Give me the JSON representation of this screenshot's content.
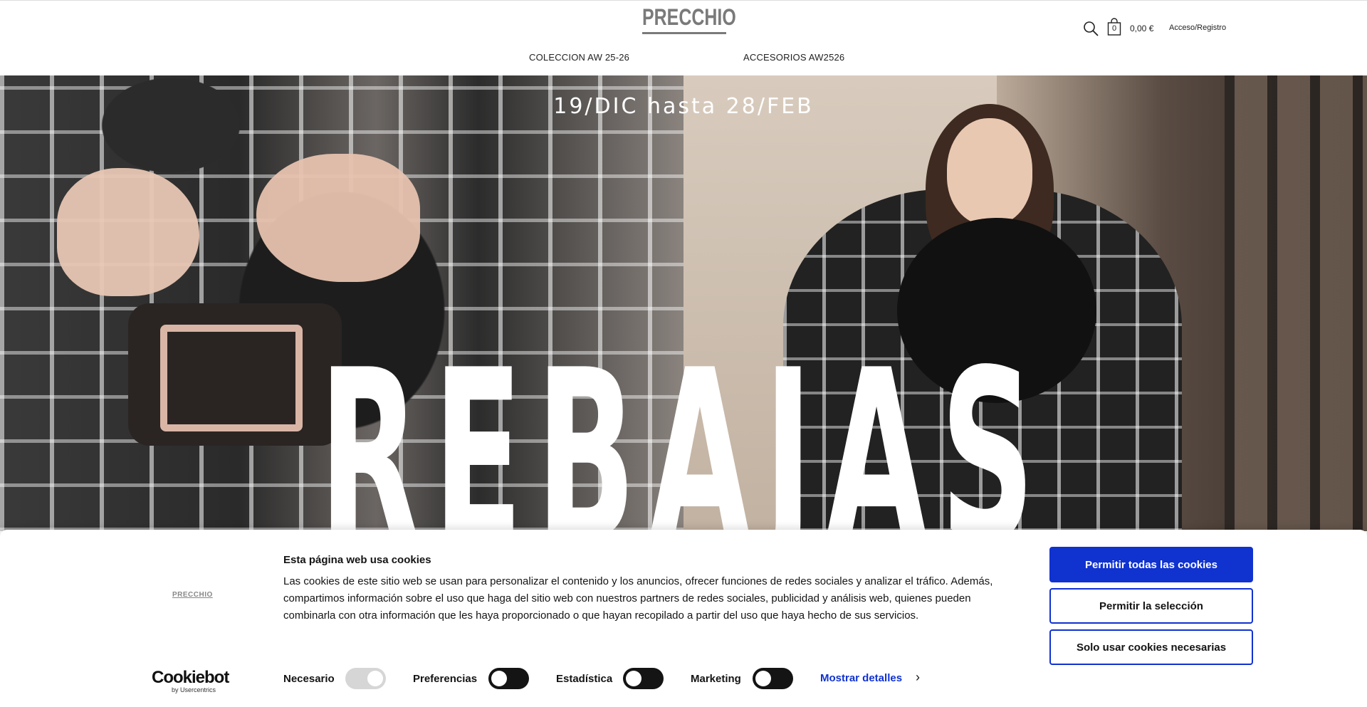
{
  "header": {
    "logo": "PRECCHIO",
    "nav": [
      "COLECCION AW 25-26",
      "ACCESORIOS AW2526"
    ],
    "cart_count": "0",
    "cart_total": "0,00 €",
    "login": "Acceso/Registro"
  },
  "hero": {
    "date": "19/DIC hasta 28/FEB",
    "title": "REBAJAS"
  },
  "cookie": {
    "logo": "PRECCHIO",
    "title": "Esta página web usa cookies",
    "text": "Las cookies de este sitio web se usan para personalizar el contenido y los anuncios, ofrecer funciones de redes sociales y analizar el tráfico. Además, compartimos información sobre el uso que haga del sitio web con nuestros partners de redes sociales, publicidad y análisis web, quienes pueden combinarla con otra información que les haya proporcionado o que hayan recopilado a partir del uso que haya hecho de sus servicios.",
    "toggles": [
      {
        "label": "Necesario",
        "checked": true,
        "disabled": true
      },
      {
        "label": "Preferencias",
        "checked": false
      },
      {
        "label": "Estadística",
        "checked": false
      },
      {
        "label": "Marketing",
        "checked": false
      }
    ],
    "details": "Mostrar detalles",
    "buttons": {
      "allow_all": "Permitir todas las cookies",
      "allow_selection": "Permitir la selección",
      "necessary_only": "Solo usar cookies necesarias"
    },
    "provider_name": "Cookiebot",
    "provider_by": "by Usercentrics"
  },
  "colors": {
    "accent": "#1032cf",
    "text": "#141414"
  }
}
